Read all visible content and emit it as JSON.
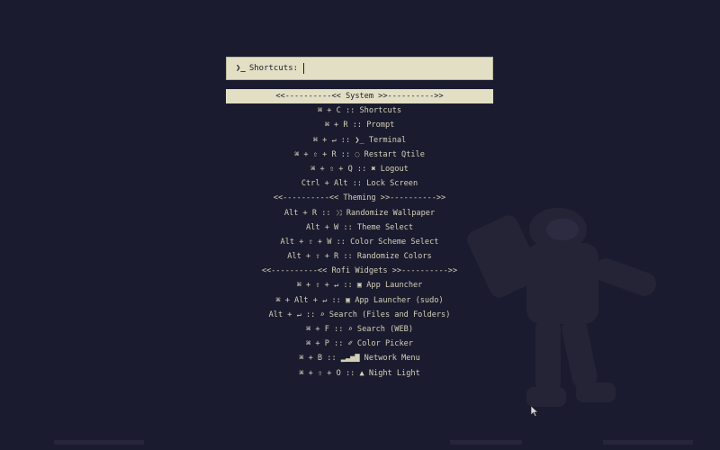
{
  "prompt": {
    "icon": "❯_",
    "label": "Shortcuts:",
    "value": ""
  },
  "entries": [
    {
      "text": "<<----------<< System >>---------->>",
      "selected": true,
      "kind": "section"
    },
    {
      "text": "⌘ + C :: Shortcuts",
      "kind": "item"
    },
    {
      "text": "⌘ + R :: Prompt",
      "kind": "item"
    },
    {
      "text": "⌘ + ↵ :: ❯_ Terminal",
      "kind": "item"
    },
    {
      "text": "⌘ + ⇧ + R :: ◌ Restart Qtile",
      "kind": "item"
    },
    {
      "text": "⌘ + ⇧ + Q :: ✖ Logout",
      "kind": "item"
    },
    {
      "text": "Ctrl + Alt :: Lock Screen",
      "kind": "item"
    },
    {
      "text": "<<----------<< Theming >>---------->>",
      "kind": "section"
    },
    {
      "text": "Alt + R :: ⤨ Randomize Wallpaper",
      "kind": "item"
    },
    {
      "text": "Alt + W :: Theme Select",
      "kind": "item"
    },
    {
      "text": "Alt + ⇧ + W :: Color Scheme Select",
      "kind": "item"
    },
    {
      "text": "Alt + ⇧ + R :: Randomize Colors",
      "kind": "item"
    },
    {
      "text": "<<----------<< Rofi Widgets >>---------->>",
      "kind": "section"
    },
    {
      "text": "⌘ + ⇧ + ↵ :: ▣ App Launcher",
      "kind": "item"
    },
    {
      "text": "⌘ + Alt + ↵ :: ▣ App Launcher (sudo)",
      "kind": "item"
    },
    {
      "text": "Alt + ↵ :: ⌕ Search (Files and Folders)",
      "kind": "item"
    },
    {
      "text": "⌘ + F :: ⌕ Search (WEB)",
      "kind": "item"
    },
    {
      "text": "⌘ + P :: ✐ Color Picker",
      "kind": "item"
    },
    {
      "text": "⌘ + B :: ▂▃▅▇ Network Menu",
      "kind": "item"
    },
    {
      "text": "⌘ + ⇧ + O :: ▲ Night Light",
      "kind": "item"
    }
  ],
  "colors": {
    "background": "#1b1b2f",
    "foreground": "#d4d0b8",
    "highlight": "#e2dfc4"
  }
}
